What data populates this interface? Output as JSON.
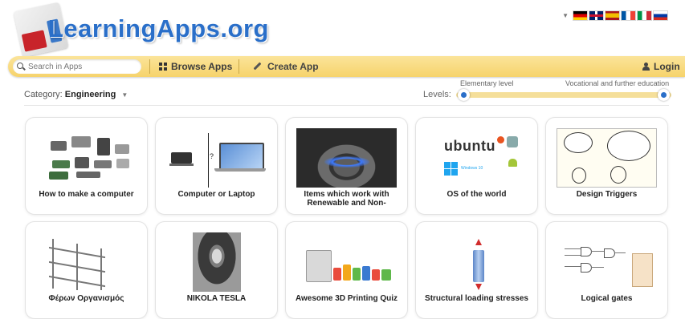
{
  "logo": {
    "text": "LearningApps.org"
  },
  "languages": {
    "dropdown_icon": "caret-down-icon",
    "flags": [
      "de",
      "gb",
      "es",
      "fr",
      "it",
      "ru"
    ]
  },
  "navbar": {
    "search_placeholder": "Search in Apps",
    "browse_label": "Browse Apps",
    "create_label": "Create App",
    "login_label": "Login",
    "bar_color": "#f6d36b"
  },
  "filter": {
    "category_label": "Category:",
    "category_value": "Engineering",
    "levels_label": "Levels:",
    "level_min_label": "Elementary level",
    "level_max_label": "Vocational and further education"
  },
  "cards": [
    {
      "title": "How to make a computer"
    },
    {
      "title": "Computer or Laptop"
    },
    {
      "title": "Items which work with Renewable and Non-"
    },
    {
      "title": "OS of the world"
    },
    {
      "title": "Design Triggers"
    },
    {
      "title": "Φέρων Οργανισμός"
    },
    {
      "title": "NIKOLA TESLA"
    },
    {
      "title": "Awesome 3D Printing Quiz"
    },
    {
      "title": "Structural loading stresses"
    },
    {
      "title": "Logical gates"
    }
  ],
  "thumbnail_text": {
    "ubuntu": "ubuntu",
    "windows": "Windows 10",
    "laptop_question": "?"
  }
}
